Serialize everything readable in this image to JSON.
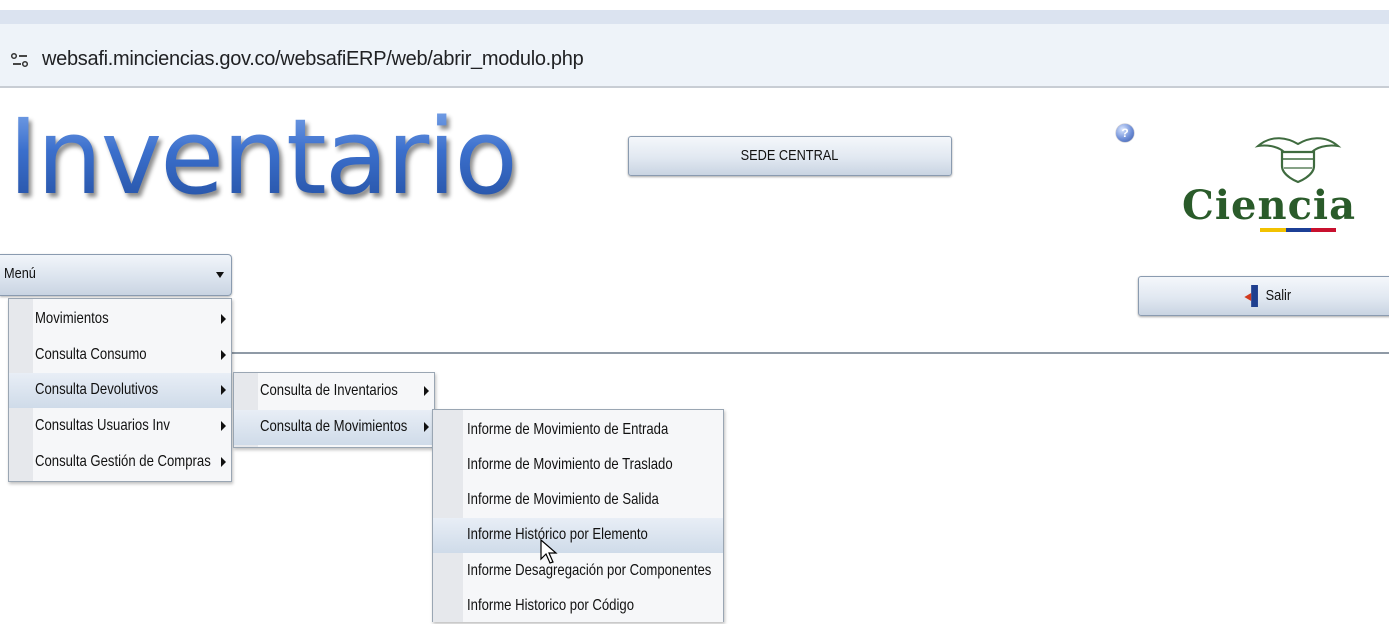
{
  "browser": {
    "url": "websafi.minciencias.gov.co/websafiERP/web/abrir_modulo.php",
    "site_info_icon": "site-info-icon"
  },
  "header": {
    "app_title": "Inventario",
    "sede_button": "SEDE CENTRAL",
    "help_icon": "?",
    "logo_text": "Ciencia",
    "salir_button": "Salir"
  },
  "menu": {
    "select_label": "Menú",
    "items": [
      {
        "label": "Movimientos"
      },
      {
        "label": "Consulta Consumo"
      },
      {
        "label": "Consulta Devolutivos",
        "selected": true
      },
      {
        "label": "Consultas Usuarios Inv"
      },
      {
        "label": "Consulta Gestión de Compras"
      }
    ],
    "submenu": [
      {
        "label": "Consulta de Inventarios"
      },
      {
        "label": "Consulta de Movimientos",
        "selected": true
      }
    ],
    "subsubmenu": [
      {
        "label": "Informe de Movimiento de Entrada"
      },
      {
        "label": "Informe de Movimiento de Traslado"
      },
      {
        "label": "Informe de Movimiento de Salida"
      },
      {
        "label": "Informe Histórico por Elemento",
        "selected": true
      },
      {
        "label": "Informe Desagregación por Componentes"
      },
      {
        "label": "Informe Historico por Código"
      }
    ]
  },
  "colors": {
    "title_blue": "#2f5fb0",
    "selected_row": "#cfdbe9",
    "menu_bg": "#f6f7f9"
  }
}
